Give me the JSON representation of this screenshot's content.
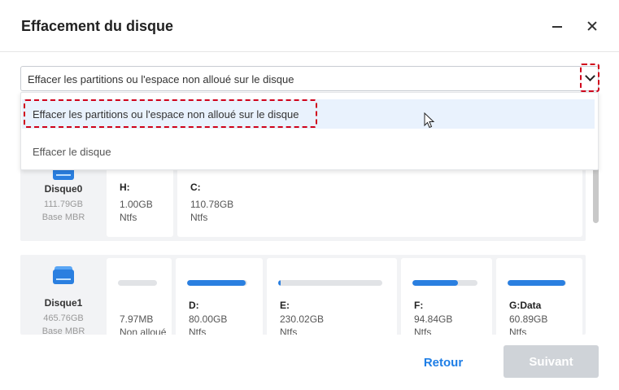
{
  "window": {
    "title": "Effacement du disque",
    "minimize_icon": "minimize-icon",
    "close_icon": "close-icon"
  },
  "select": {
    "value": "Effacer les partitions ou l'espace non alloué sur le disque",
    "options": [
      "Effacer les partitions ou l'espace non alloué sur le disque",
      "Effacer le disque"
    ],
    "highlighted_index": 0
  },
  "disks": [
    {
      "name": "Disque0",
      "size": "111.79GB",
      "type": "Base MBR",
      "partitions": [
        {
          "name": "H:",
          "size": "1.00GB",
          "fs": "Ntfs"
        },
        {
          "name": "C:",
          "size": "110.78GB",
          "fs": "Ntfs"
        }
      ]
    },
    {
      "name": "Disque1",
      "size": "465.76GB",
      "type": "Base MBR",
      "partitions": [
        {
          "name": "",
          "size": "7.97MB",
          "fs": "Non alloué",
          "used": 0.0
        },
        {
          "name": "D:",
          "size": "80.00GB",
          "fs": "Ntfs",
          "used": 0.97
        },
        {
          "name": "E:",
          "size": "230.02GB",
          "fs": "Ntfs",
          "used": 0.02
        },
        {
          "name": "F:",
          "size": "94.84GB",
          "fs": "Ntfs",
          "used": 0.7
        },
        {
          "name": "G:Data",
          "size": "60.89GB",
          "fs": "Ntfs",
          "used": 0.99
        }
      ]
    }
  ],
  "footer": {
    "back_label": "Retour",
    "next_label": "Suivant"
  },
  "colors": {
    "accent": "#1e7ee6",
    "bar_fill": "#2a7fe0",
    "highlight_border": "#d0021b",
    "disabled_button": "#cfd3d8"
  }
}
